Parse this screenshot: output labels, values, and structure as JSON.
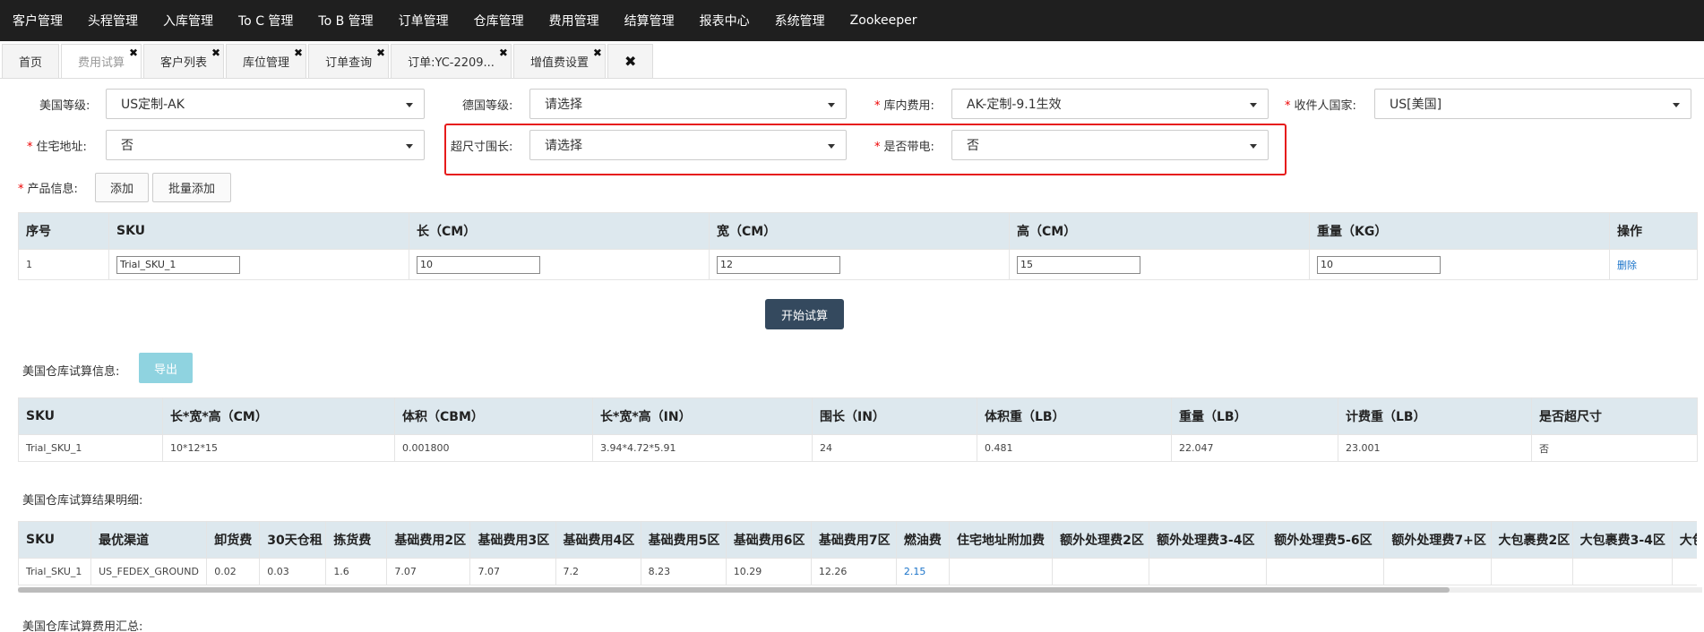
{
  "nav": [
    "客户管理",
    "头程管理",
    "入库管理",
    "To C 管理",
    "To B 管理",
    "订单管理",
    "仓库管理",
    "费用管理",
    "结算管理",
    "报表中心",
    "系统管理",
    "Zookeeper"
  ],
  "tabs": {
    "home": "首页",
    "fee_trial": "费用试算",
    "customer_list": "客户列表",
    "location_mgmt": "库位管理",
    "order_query": "订单查询",
    "order_detail": "订单:YC-2209...",
    "vas_settings": "增值费设置",
    "close_symbol": "✖"
  },
  "form": {
    "us_level": {
      "label": "美国等级:",
      "value": "US定制-AK"
    },
    "de_level": {
      "label": "德国等级:",
      "value": "请选择"
    },
    "warehouse_fee": {
      "label": "库内费用:",
      "value": "AK-定制-9.1生效"
    },
    "receiver_country": {
      "label": "收件人国家:",
      "value": "US[美国]"
    },
    "residential": {
      "label": "住宅地址:",
      "value": "否"
    },
    "oversize_girth": {
      "label": "超尺寸围长:",
      "value": "请选择"
    },
    "battery": {
      "label": "是否带电:",
      "value": "否"
    },
    "product_info": {
      "label": "产品信息:"
    },
    "required_mark": "*"
  },
  "buttons": {
    "add": "添加",
    "batch_add": "批量添加",
    "start_trial": "开始试算",
    "export": "导出",
    "delete": "删除"
  },
  "product_table": {
    "headers": [
      "序号",
      "SKU",
      "长（CM）",
      "宽（CM）",
      "高（CM）",
      "重量（KG）",
      "操作"
    ],
    "rows": [
      {
        "no": "1",
        "sku": "Trial_SKU_1",
        "length": "10",
        "width": "12",
        "height": "15",
        "weight": "10"
      }
    ]
  },
  "us_info": {
    "title": "美国仓库试算信息:",
    "headers": [
      "SKU",
      "长*宽*高（CM）",
      "体积（CBM）",
      "长*宽*高（IN）",
      "围长（IN）",
      "体积重（LB）",
      "重量（LB）",
      "计费重（LB）",
      "是否超尺寸"
    ],
    "rows": [
      [
        "Trial_SKU_1",
        "10*12*15",
        "0.001800",
        "3.94*4.72*5.91",
        "24",
        "0.481",
        "22.047",
        "23.001",
        "否"
      ]
    ]
  },
  "us_detail": {
    "title": "美国仓库试算结果明细:",
    "headers": [
      "SKU",
      "最优渠道",
      "卸货费",
      "30天仓租",
      "拣货费",
      "基础费用2区",
      "基础费用3区",
      "基础费用4区",
      "基础费用5区",
      "基础费用6区",
      "基础费用7区",
      "燃油费",
      "住宅地址附加费",
      "额外处理费2区",
      "额外处理费3-4区",
      "额外处理费5-6区",
      "额外处理费7+区",
      "大包裹费2区",
      "大包裹费3-4区",
      "大包"
    ],
    "rows": [
      [
        "Trial_SKU_1",
        "US_FEDEX_GROUND",
        "0.02",
        "0.03",
        "1.6",
        "7.07",
        "7.07",
        "7.2",
        "8.23",
        "10.29",
        "12.26",
        "2.15",
        "",
        "",
        "",
        "",
        "",
        "",
        "",
        ""
      ]
    ]
  },
  "us_summary": {
    "title": "美国仓库试算费用汇总:"
  }
}
